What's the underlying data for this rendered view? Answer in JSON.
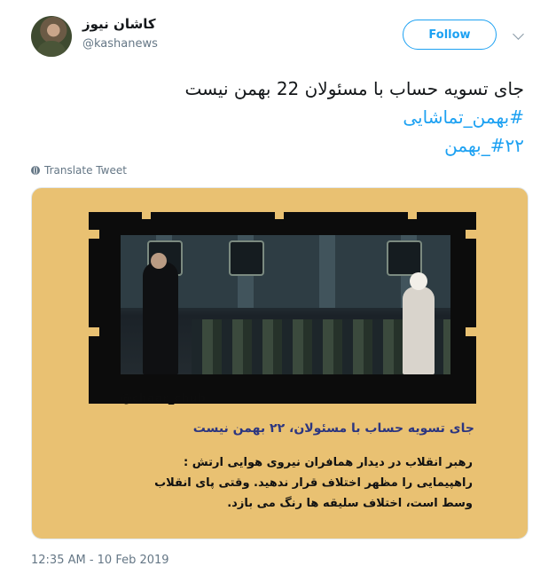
{
  "author": {
    "display_name": "کاشان نیوز",
    "handle": "@kashanews",
    "follow_label": "Follow"
  },
  "tweet": {
    "text": "جای تسویه حساب با مسئولان 22 بهمن نیست",
    "hashtags": [
      "#بهمن_تماشایی",
      "#۲۲_بهمن"
    ]
  },
  "translate_label": "Translate Tweet",
  "card": {
    "watermark": "@chaar_chub",
    "title": "جای تسویه حساب با مسئولان، ۲۲ بهمن نیست",
    "body_lines": [
      "رهبر انقلاب در دیدار همافران نیروی هوایی ارتش :",
      "راهپیمایی را مظهر اختلاف قرار ندهید. وقتی پای انقلاب",
      "وسط است، اختلاف سلیقه ها رنگ می بازد."
    ]
  },
  "timestamp": "12:35 AM - 10 Feb 2019",
  "colors": {
    "accent": "#1da1f2",
    "card_background": "#e9c172",
    "card_title": "#2c3680"
  }
}
